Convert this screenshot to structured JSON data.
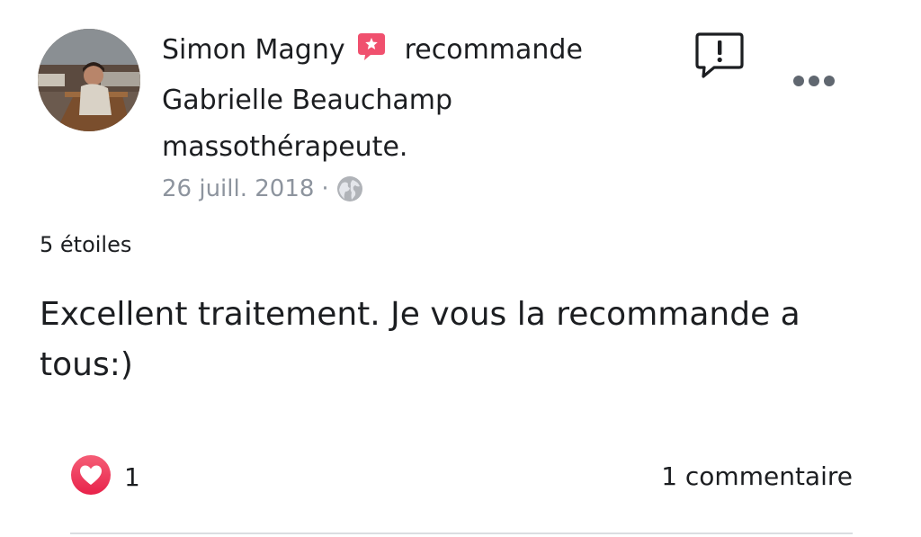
{
  "post": {
    "author": "Simon Magny",
    "action": "recommande",
    "subject_line1": "Gabrielle Beauchamp",
    "subject_line2": "massothérapeute.",
    "date": "26 juill. 2018",
    "separator": "·",
    "privacy_icon": "globe-icon",
    "recommend_icon": "recommend-badge-icon",
    "rating": "5 étoiles",
    "review_text": "Excellent traitement. Je vous la recommande  a tous:)"
  },
  "actions": {
    "report_icon": "report-icon",
    "more_icon": "more-options-icon"
  },
  "footer": {
    "reaction_icon": "heart-reaction-icon",
    "reaction_count": "1",
    "comments_label": "1 commentaire"
  },
  "colors": {
    "text": "#1c1e21",
    "meta": "#8d949e",
    "badge": "#f0506e",
    "heart": "#f33e58",
    "divider": "#dadde1"
  }
}
